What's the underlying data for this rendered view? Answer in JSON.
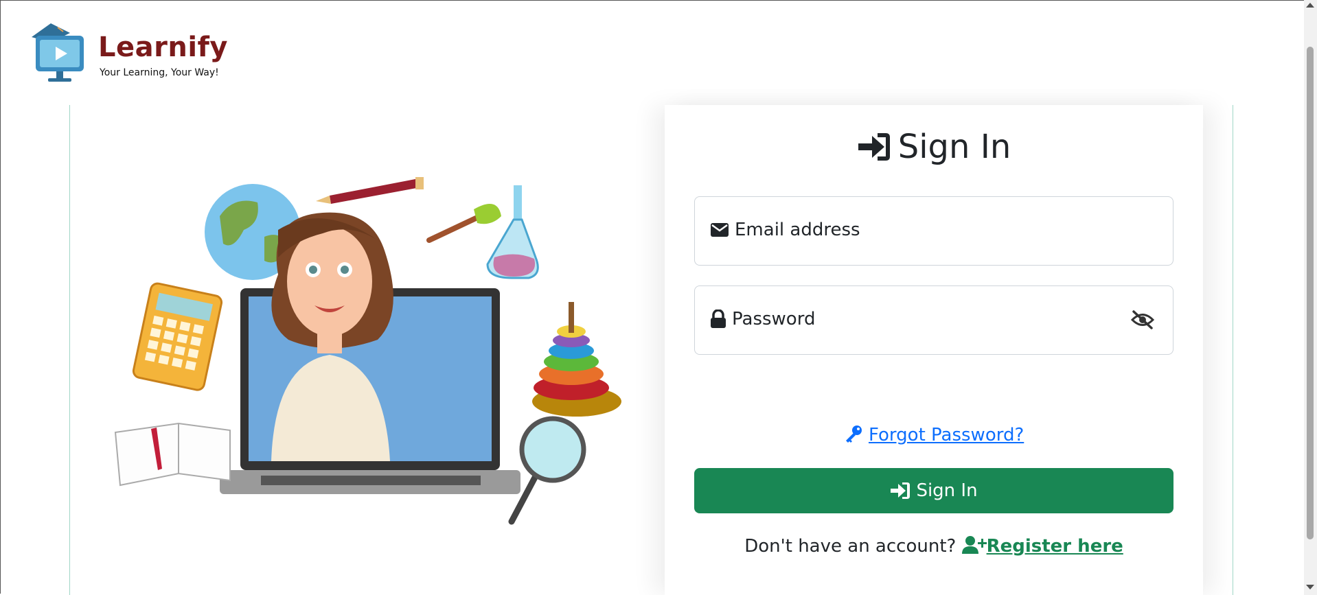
{
  "brand": {
    "name": "Learnify",
    "tagline": "Your Learning, Your Way!"
  },
  "form": {
    "title": "Sign In",
    "email_placeholder": "Email address",
    "password_placeholder": "Password",
    "forgot_label": "Forgot Password?",
    "submit_label": "Sign In",
    "register_prompt": "Don't have an account?",
    "register_link": "Register here"
  },
  "icons": {
    "title": "sign-in-icon",
    "email": "envelope-icon",
    "password": "lock-icon",
    "toggle": "eye-slash-icon",
    "forgot": "key-icon",
    "submit": "sign-in-icon",
    "register": "user-plus-icon"
  },
  "colors": {
    "primary_button": "#198754",
    "link": "#0d6efd",
    "register_link": "#198754",
    "brand_title": "#7a1a1a"
  }
}
